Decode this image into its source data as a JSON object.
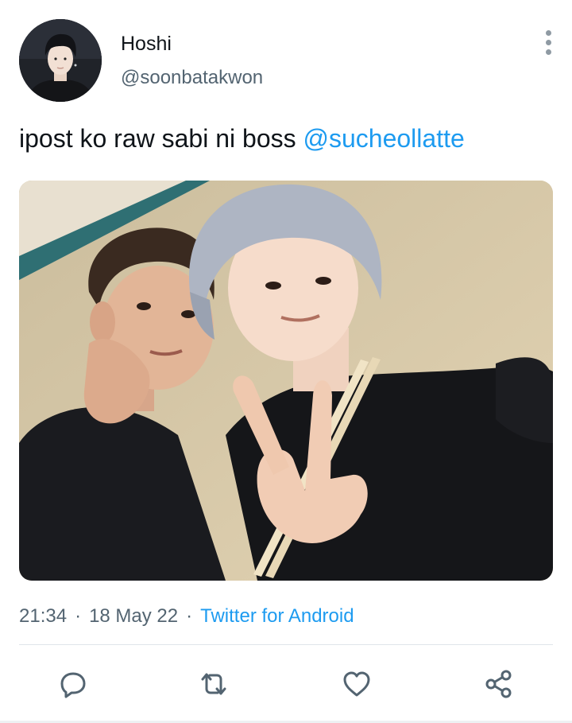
{
  "tweet": {
    "author": {
      "display_name": "Hoshi",
      "handle": "@soonbatakwon"
    },
    "text": "ipost ko raw sabi ni boss",
    "mention": "@sucheollatte",
    "time": "21:34",
    "date": "18 May 22",
    "source": "Twitter for Android",
    "separator": "·"
  },
  "actions": {
    "reply": "reply-icon",
    "retweet": "retweet-icon",
    "like": "heart-icon",
    "share": "share-icon"
  },
  "colors": {
    "link": "#1d9bf0",
    "secondary_text": "#536471",
    "primary_text": "#0f1419",
    "icon": "#536471"
  }
}
